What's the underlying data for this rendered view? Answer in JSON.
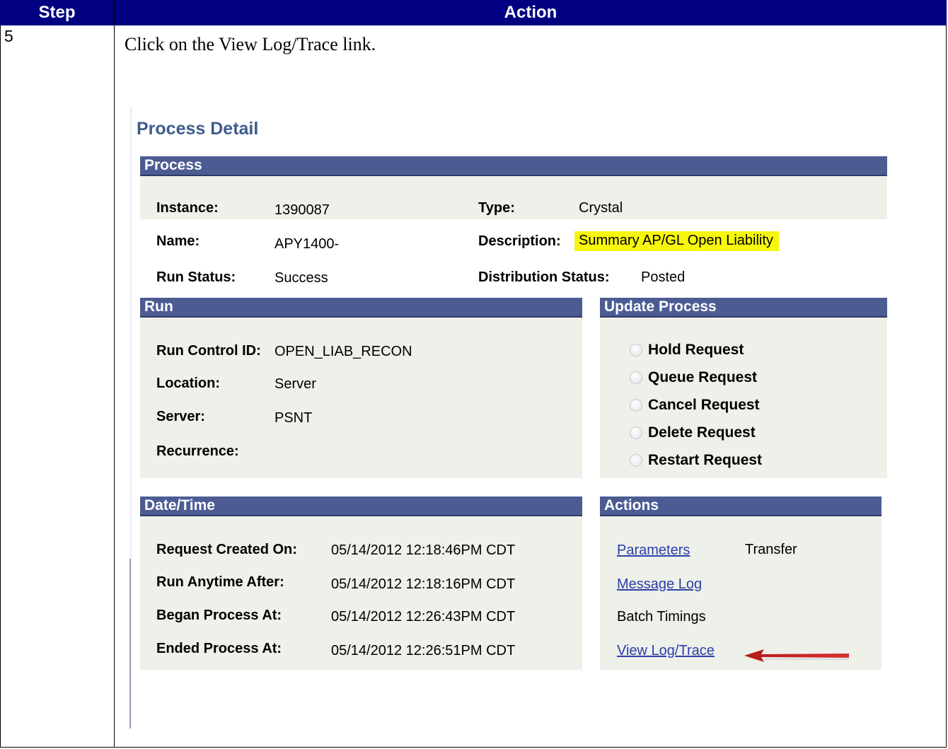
{
  "table": {
    "header_step": "Step",
    "header_action": "Action",
    "step_number": "5",
    "instruction": "Click on the View Log/Trace link."
  },
  "screen": {
    "title": "Process Detail",
    "process": {
      "header": "Process",
      "instance_label": "Instance:",
      "instance_value": "1390087",
      "type_label": "Type:",
      "type_value": "Crystal",
      "name_label": "Name:",
      "name_value": "APY1400-",
      "description_label": "Description:",
      "description_value": "Summary AP/GL Open Liability",
      "run_status_label": "Run Status:",
      "run_status_value": "Success",
      "distribution_status_label": "Distribution Status:",
      "distribution_status_value": "Posted"
    },
    "run": {
      "header": "Run",
      "run_control_label": "Run Control ID:",
      "run_control_value": "OPEN_LIAB_RECON",
      "location_label": "Location:",
      "location_value": "Server",
      "server_label": "Server:",
      "server_value": "PSNT",
      "recurrence_label": "Recurrence:"
    },
    "update_process": {
      "header": "Update Process",
      "options": [
        "Hold Request",
        "Queue Request",
        "Cancel Request",
        "Delete Request",
        "Restart Request"
      ]
    },
    "datetime": {
      "header": "Date/Time",
      "request_created_label": "Request Created On:",
      "request_created_value": "05/14/2012 12:18:46PM CDT",
      "run_anytime_label": "Run Anytime After:",
      "run_anytime_value": "05/14/2012 12:18:16PM CDT",
      "began_label": "Began Process At:",
      "began_value": "05/14/2012 12:26:43PM CDT",
      "ended_label": "Ended Process At:",
      "ended_value": "05/14/2012 12:26:51PM CDT"
    },
    "actions": {
      "header": "Actions",
      "parameters": "Parameters",
      "transfer": "Transfer",
      "message_log": "Message Log",
      "batch_timings": "Batch Timings",
      "view_log_trace": "View Log/Trace"
    },
    "colors": {
      "section_header": "#4c5c93",
      "section_body": "#eef0ea",
      "title": "#3e5c8c",
      "link": "#2b3fa8",
      "highlight": "#f7f70b",
      "arrow": "#cc1f1f",
      "table_header": "#000080"
    }
  }
}
